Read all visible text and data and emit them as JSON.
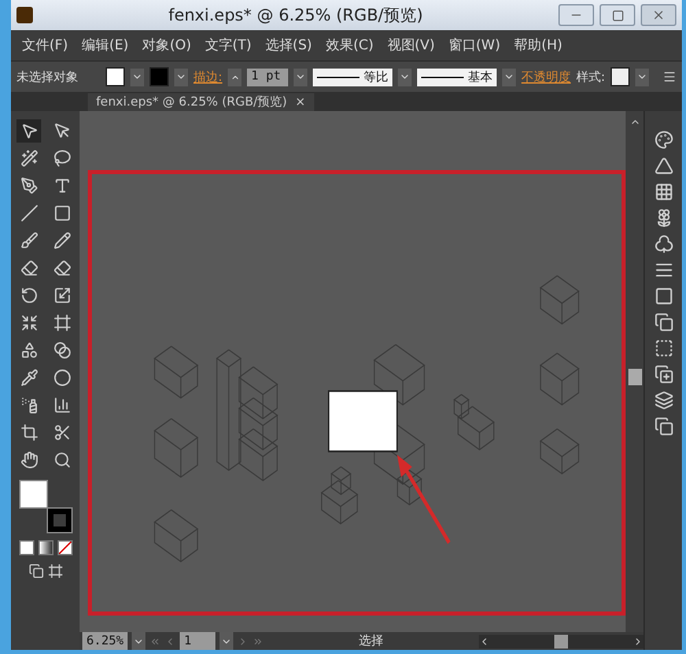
{
  "window": {
    "title": "fenxi.eps* @ 6.25% (RGB/预览)"
  },
  "menu": [
    "文件(F)",
    "编辑(E)",
    "对象(O)",
    "文字(T)",
    "选择(S)",
    "效果(C)",
    "视图(V)",
    "窗口(W)",
    "帮助(H)"
  ],
  "control_bar": {
    "selection": "未选择对象",
    "stroke_label": "描边:",
    "stroke_weight": "1 pt",
    "variable_width": "等比",
    "brush": "基本",
    "opacity_label": "不透明度",
    "style_label": "样式:"
  },
  "document_tab": {
    "title": "fenxi.eps* @ 6.25% (RGB/预览)",
    "close": "×"
  },
  "status_bar": {
    "zoom": "6.25%",
    "artboard": "1",
    "tool": "选择"
  }
}
